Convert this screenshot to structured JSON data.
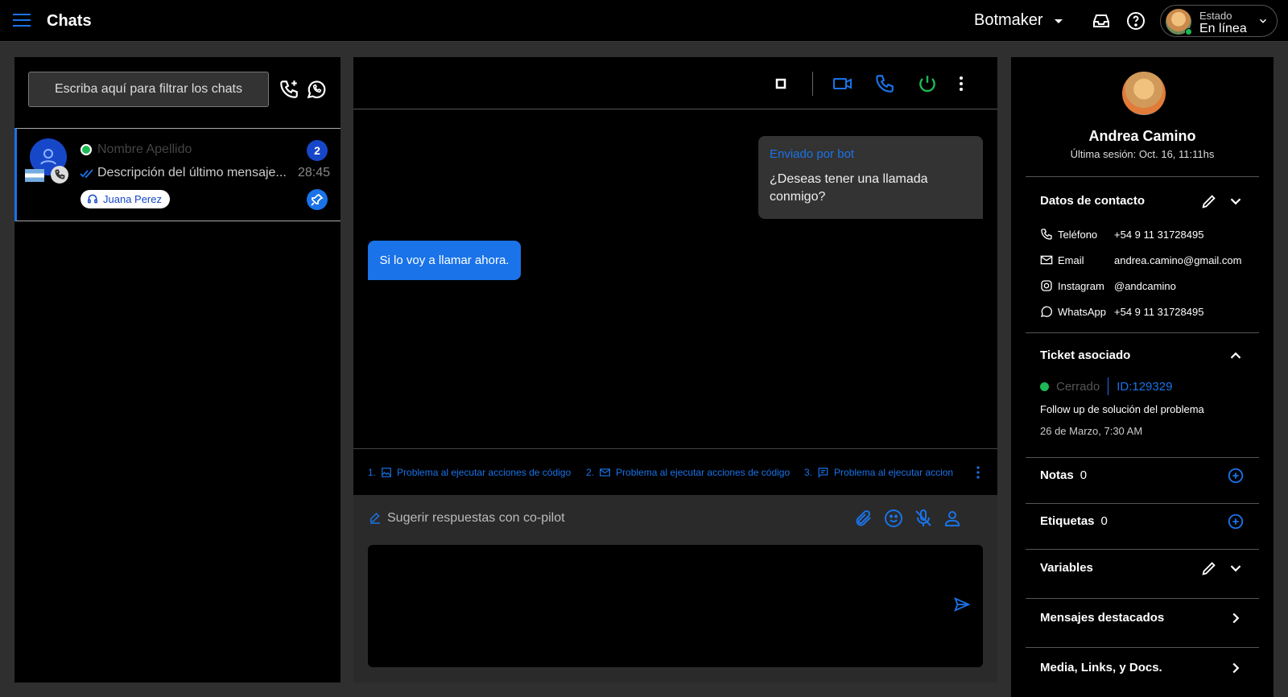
{
  "topbar": {
    "title": "Chats",
    "brand": "Botmaker",
    "status_label": "Estado",
    "status_value": "En línea"
  },
  "left": {
    "filter_placeholder": "Escriba aquí para filtrar los chats",
    "chat": {
      "name": "Nombre Apellido",
      "last_message": "Descripción del último mensaje...",
      "time": "28:45",
      "unread": "2",
      "agent": "Juana Perez"
    }
  },
  "center": {
    "bot_message_from": "Enviado por bot",
    "bot_message_text": "¿Deseas tener una llamada conmigo?",
    "user_message_text": "Si lo voy a llamar ahora.",
    "suggestions": [
      {
        "index": "1.",
        "text": "Problema al ejecutar acciones de código"
      },
      {
        "index": "2.",
        "text": "Problema al ejecutar acciones de código"
      },
      {
        "index": "3.",
        "text": "Problema al ejecutar accion"
      }
    ],
    "copilot_label": "Sugerir respuestas con co-pilot"
  },
  "right": {
    "name": "Andrea Camino",
    "last_session": "Última sesión: Oct. 16, 11:11hs",
    "contact_header": "Datos de contacto",
    "contact": [
      {
        "key": "Teléfono",
        "value": "+54 9 11 31728495"
      },
      {
        "key": "Email",
        "value": "andrea.camino@gmail.com"
      },
      {
        "key": "Instagram",
        "value": "@andcamino"
      },
      {
        "key": "WhatsApp",
        "value": "+54 9 11 31728495"
      }
    ],
    "ticket_header": "Ticket asociado",
    "ticket_status": "Cerrado",
    "ticket_id": "ID:129329",
    "ticket_desc": "Follow up de solución del problema",
    "ticket_date": "26 de Marzo, 7:30 AM",
    "notes_header": "Notas",
    "notes_count": "0",
    "tags_header": "Etiquetas",
    "tags_count": "0",
    "variables_header": "Variables",
    "featured_header": "Mensajes destacados",
    "media_header": "Media, Links, y Docs."
  },
  "colors": {
    "accent": "#1a73e8",
    "online": "#1db954",
    "panel": "#000000",
    "background": "#2f2f2f"
  }
}
